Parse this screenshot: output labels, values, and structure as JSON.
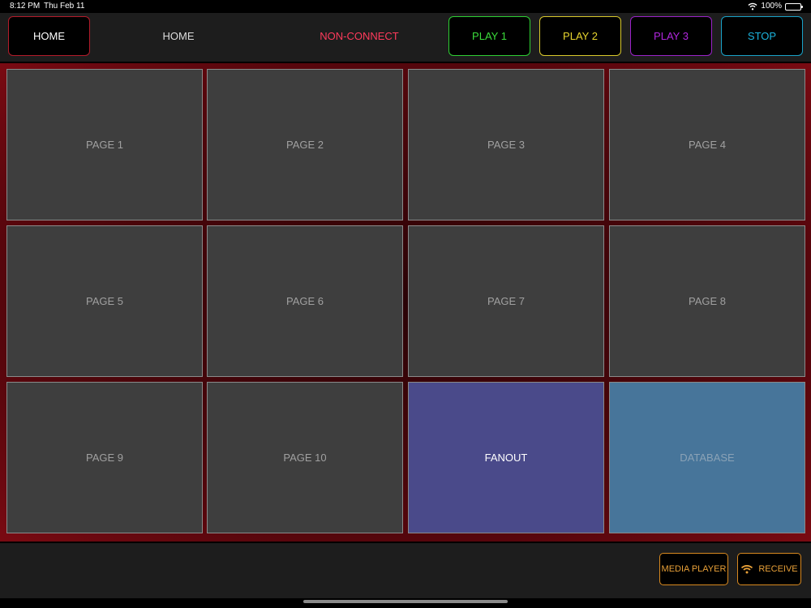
{
  "status_bar": {
    "time": "8:12 PM",
    "date": "Thu Feb 11",
    "battery": "100%"
  },
  "top_bar": {
    "home_button": "HOME",
    "current_page": "HOME",
    "connection_status": "NON-CONNECT",
    "play1": "PLAY 1",
    "play2": "PLAY 2",
    "play3": "PLAY 3",
    "stop": "STOP"
  },
  "tiles": [
    "PAGE 1",
    "PAGE 2",
    "PAGE 3",
    "PAGE 4",
    "PAGE 5",
    "PAGE 6",
    "PAGE 7",
    "PAGE 8",
    "PAGE 9",
    "PAGE 10",
    "FANOUT",
    "DATABASE"
  ],
  "bottom_bar": {
    "media_player": "MEDIA PLAYER",
    "receive": "RECEIVE"
  },
  "colors": {
    "home_border": "#b31b2a",
    "play1": "#3bdc3b",
    "play2": "#e8d52f",
    "play3": "#b127de",
    "stop": "#1cb4de",
    "non_connect": "#ff3b5c",
    "fanout_bg": "#4a4a8a",
    "database_bg": "#47759a",
    "accent_orange": "#e8a038"
  }
}
